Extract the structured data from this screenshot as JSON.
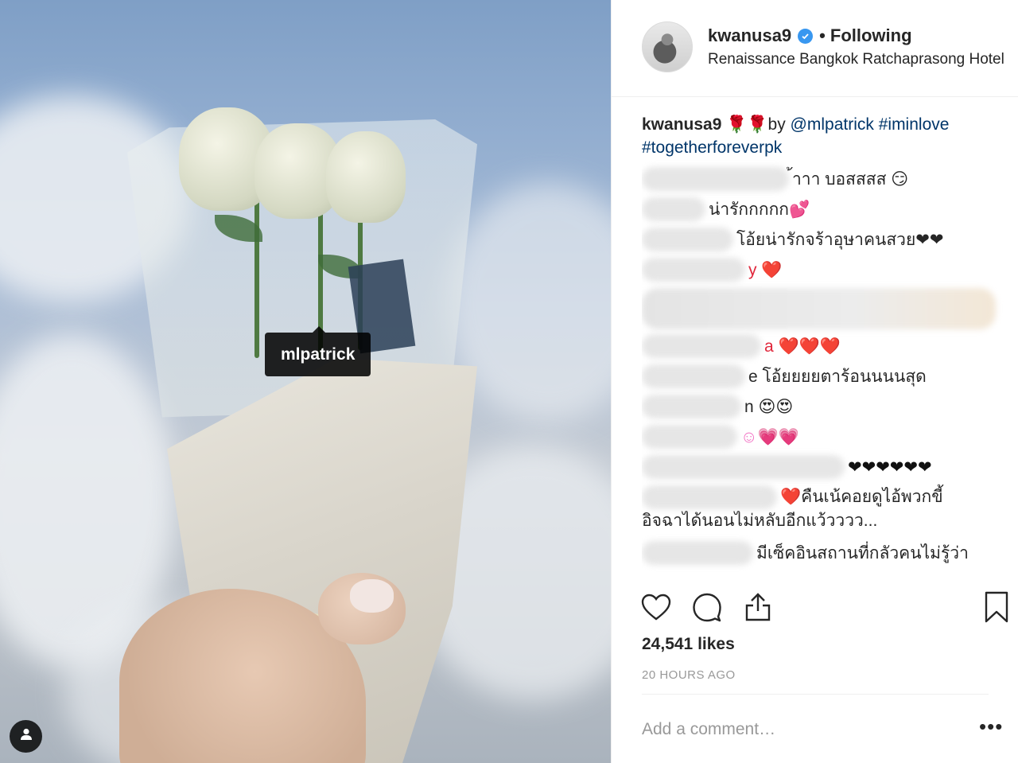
{
  "photo": {
    "tag_label": "mlpatrick",
    "user_tag_button_icon": "person-icon"
  },
  "header": {
    "username": "kwanusa9",
    "verified_icon": "verified-badge-icon",
    "separator": "•",
    "follow_status": "Following",
    "location": "Renaissance Bangkok Ratchaprasong Hotel"
  },
  "caption": {
    "username": "kwanusa9",
    "emoji": "🌹🌹",
    "text_by": "by ",
    "mention": "@mlpatrick",
    "hashtag1": "#iminlove",
    "hashtag2": "#togetherforeverpk"
  },
  "comments": [
    {
      "text": "้าาา บอสสสส 😏"
    },
    {
      "text": "น่ารักกกกก💕"
    },
    {
      "text": "โอ้ยน่ารักจร้าอุษาคนสวย❤❤"
    },
    {
      "text": "y ❤️"
    },
    {
      "text": ""
    },
    {
      "text": "a ❤️❤️❤️"
    },
    {
      "text": "e โอ้ยยยยตาร้อนนนนสุด"
    },
    {
      "text": "n 😍😍"
    },
    {
      "text": "☺💗💗"
    },
    {
      "text": "❤❤❤❤❤❤"
    },
    {
      "text": "❤️คืนเน้คอยดูไอ้พวกขี้",
      "text2": "อิจฉาได้นอนไม่หลับอีกแว้วววว..."
    },
    {
      "text": "มีเซ็คอินสถานที่กลัวคนไม่รู้ว่า"
    }
  ],
  "actions": {
    "like_icon": "heart-icon",
    "comment_icon": "comment-bubble-icon",
    "share_icon": "share-icon",
    "save_icon": "bookmark-icon"
  },
  "likes": "24,541 likes",
  "timestamp": "20 HOURS AGO",
  "add_comment": {
    "placeholder": "Add a comment…"
  },
  "more_options": "•••",
  "colors": {
    "link": "#003569",
    "verified": "#3897f0",
    "muted": "#999999",
    "border": "#efefef"
  }
}
